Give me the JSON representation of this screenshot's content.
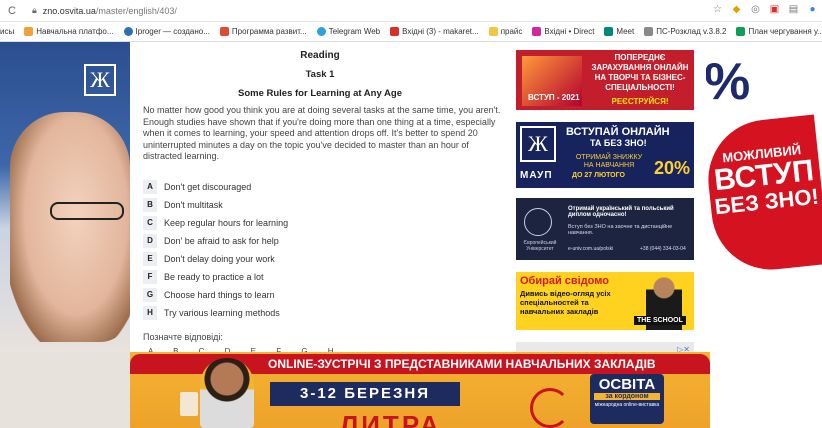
{
  "browser": {
    "url_host": "zno.osvita.ua",
    "url_path": "/master/english/403/",
    "bookmarks": [
      {
        "label": "исы",
        "color": "#ffffff"
      },
      {
        "label": "Навчальна платфо...",
        "color": "#f0a23a"
      },
      {
        "label": "Iproger — создано...",
        "color": "#2f6fb5"
      },
      {
        "label": "Программа развит...",
        "color": "#e04a2f"
      },
      {
        "label": "Telegram Web",
        "color": "#2aa2dc"
      },
      {
        "label": "Вхідні (3) - makaret...",
        "color": "#d93025"
      },
      {
        "label": "прайс",
        "color": "#f4c542"
      },
      {
        "label": "Вхідні • Direct",
        "color": "#d6249f"
      },
      {
        "label": "Meet",
        "color": "#00897b"
      },
      {
        "label": "ПС-Розклад v.3.8.2",
        "color": "#8a8a8a"
      },
      {
        "label": "План чергування у...",
        "color": "#0f9d58"
      }
    ]
  },
  "content": {
    "heading": "Reading",
    "task": "Task 1",
    "title": "Some Rules for Learning at Any Age",
    "passage": "No matter how good you think you are at doing several tasks at the same time, you aren't. Enough studies have shown that if you're doing more than one thing at a time, especially when it comes to learning, your speed and attention drops off. It's better to spend 20 uninterrupted minutes a day on the topic you've decided to master than an hour of distracted learning.",
    "options": [
      {
        "letter": "A",
        "text": "Don't get discouraged"
      },
      {
        "letter": "B",
        "text": "Don't multitask"
      },
      {
        "letter": "C",
        "text": "Keep regular hours for learning"
      },
      {
        "letter": "D",
        "text": "Don' be afraid to ask for help"
      },
      {
        "letter": "E",
        "text": "Don't delay doing your work"
      },
      {
        "letter": "F",
        "text": "Be ready to practice a lot"
      },
      {
        "letter": "G",
        "text": "Choose hard things to learn"
      },
      {
        "letter": "H",
        "text": "Try various learning methods"
      }
    ],
    "answer_label": "Позначте відповіді:",
    "answer_letters": "A B C D E F G H"
  },
  "ads": {
    "ad1": {
      "year_text": "ВСТУП - 2021",
      "headline": "ПОПЕРЕДНЄ ЗАРАХУВАННЯ ОНЛАЙН НА ТВОРЧІ ТА БІЗНЕС-СПЕЦІАЛЬНОСТІ!",
      "cta": "РЕЄСТРУЙСЯ!"
    },
    "ad2": {
      "brand": "МАУП",
      "line1": "ВСТУПАЙ ОНЛАЙН",
      "line2": "ТА БЕЗ ЗНО!",
      "line3": "ОТРИМАЙ ЗНИЖКУ НА НАВЧАННЯ",
      "line4": "ДО 27 ЛЮТОГО",
      "discount": "20%"
    },
    "ad3": {
      "line1": "Отримай український та польський диплом одночасно!",
      "line2": "Вступ без ЗНО на заочне та дистанційне навчання.",
      "site": "e-univ.com.ua/polski",
      "phone": "+38 (044) 334-03-04",
      "uni": "Європейський Університет"
    },
    "ad4": {
      "headline": "Обирай свідомо",
      "sub": "Дивись відео-огляд усіх спеціальностей та навчальних закладів",
      "brand": "THE SCHOOL"
    }
  },
  "sides": {
    "left_logo": "Ж",
    "right_pct": "%",
    "right_promo_1": "МОЖЛИВИЙ",
    "right_promo_2": "ВСТУП",
    "right_promo_3": "БЕЗ ЗНО!"
  },
  "banner": {
    "headline": "ONLINE-ЗУСТРІЧІ З ПРЕДСТАВНИКАМИ НАВЧАЛЬНИХ ЗАКЛАДІВ",
    "dates": "3-12 БЕРЕЗНЯ",
    "litra": "ЛИТРА",
    "brand": "ОСВІТА",
    "brand_sub": "за кордоном",
    "brand_tag": "міжнародна online-виставка"
  }
}
